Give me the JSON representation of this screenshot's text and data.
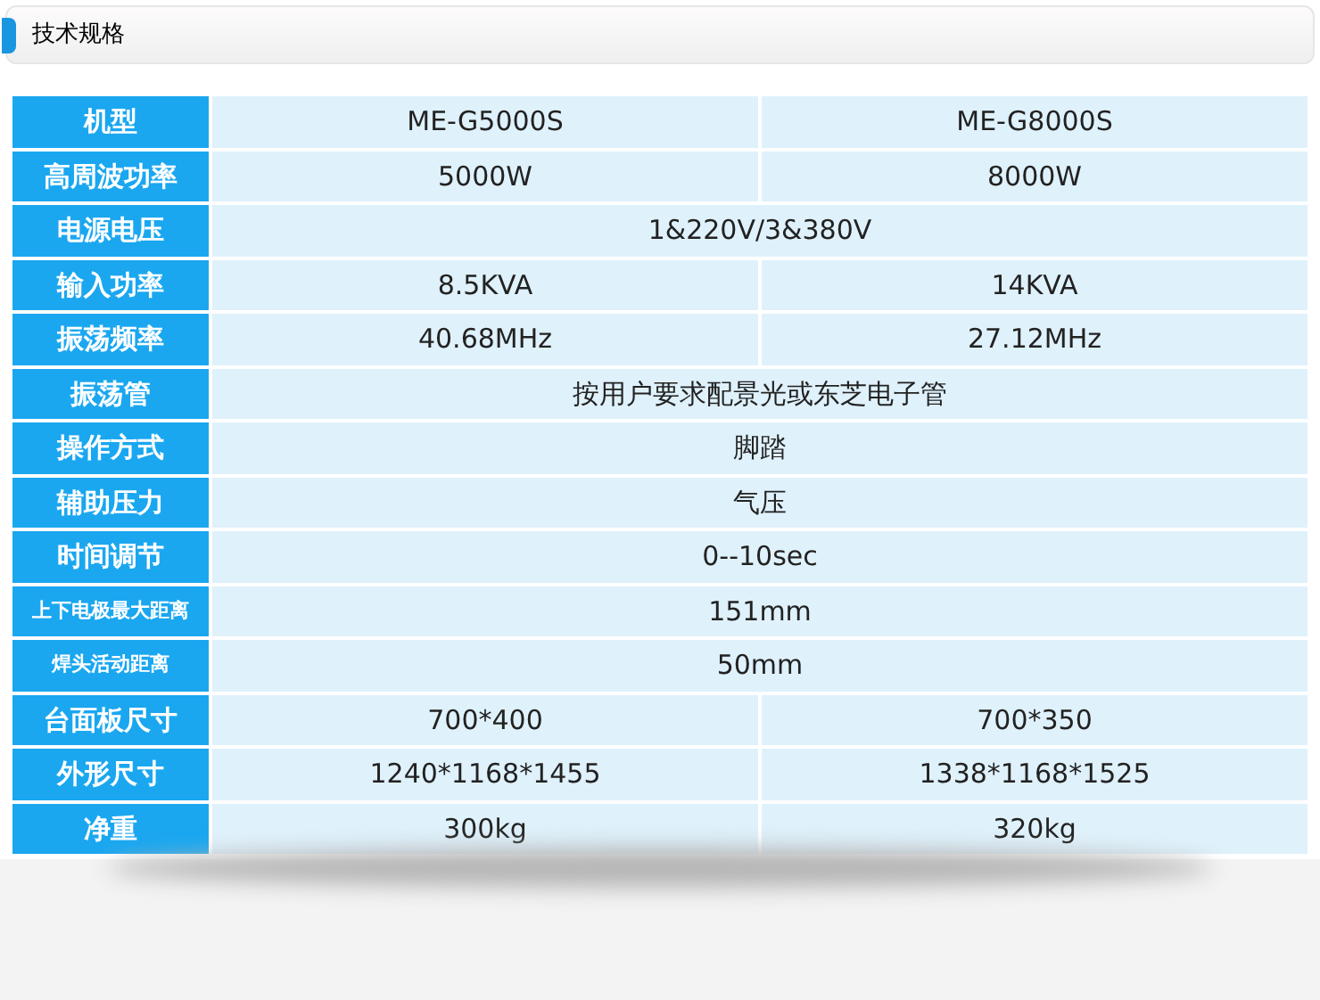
{
  "section_title": "技术规格",
  "rows": [
    {
      "label": "机型",
      "values": [
        "ME-G5000S",
        "ME-G8000S"
      ]
    },
    {
      "label": "高周波功率",
      "values": [
        "5000W",
        "8000W"
      ]
    },
    {
      "label": "电源电压",
      "values": [
        "1&220V/3&380V"
      ]
    },
    {
      "label": "输入功率",
      "values": [
        "8.5KVA",
        "14KVA"
      ]
    },
    {
      "label": "振荡频率",
      "values": [
        "40.68MHz",
        "27.12MHz"
      ]
    },
    {
      "label": "振荡管",
      "values": [
        "按用户要求配景光或东芝电子管"
      ]
    },
    {
      "label": "操作方式",
      "values": [
        "脚踏"
      ]
    },
    {
      "label": "辅助压力",
      "values": [
        "气压"
      ]
    },
    {
      "label": "时间调节",
      "values": [
        "0--10sec"
      ]
    },
    {
      "label": "上下电极最大距离",
      "values": [
        "151mm"
      ]
    },
    {
      "label": "焊头活动距离",
      "values": [
        "50mm"
      ]
    },
    {
      "label": "台面板尺寸",
      "values": [
        "700*400",
        "700*350"
      ]
    },
    {
      "label": "外形尺寸",
      "values": [
        "1240*1168*1455",
        "1338*1168*1525"
      ]
    },
    {
      "label": "净重",
      "values": [
        "300kg",
        "320kg"
      ]
    }
  ]
}
